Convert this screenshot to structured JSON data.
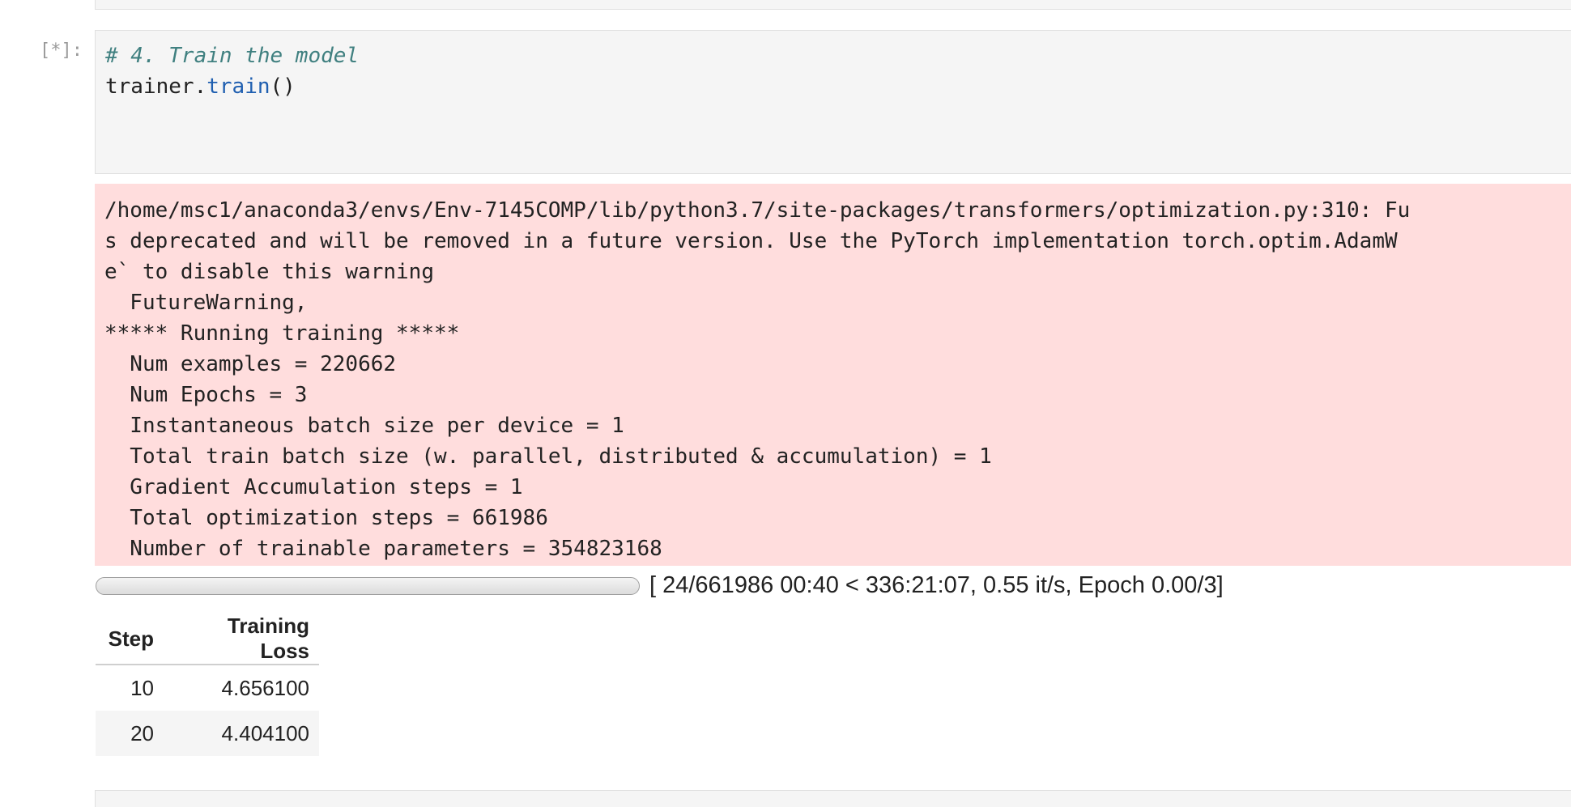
{
  "cell": {
    "prompt": "[*]:",
    "code": {
      "comment": "# 4. Train the model",
      "line2_obj": "trainer.",
      "line2_fn": "train",
      "line2_rest": "()"
    }
  },
  "stderr": {
    "lines": [
      "/home/msc1/anaconda3/envs/Env-7145COMP/lib/python3.7/site-packages/transformers/optimization.py:310: Fu",
      "s deprecated and will be removed in a future version. Use the PyTorch implementation torch.optim.AdamW",
      "e` to disable this warning",
      "  FutureWarning,",
      "***** Running training *****",
      "  Num examples = 220662",
      "  Num Epochs = 3",
      "  Instantaneous batch size per device = 1",
      "  Total train batch size (w. parallel, distributed & accumulation) = 1",
      "  Gradient Accumulation steps = 1",
      "  Total optimization steps = 661986",
      "  Number of trainable parameters = 354823168"
    ]
  },
  "progress": {
    "fraction": 3.63e-05,
    "text": "[ 24/661986 00:40 < 336:21:07, 0.55 it/s, Epoch 0.00/3]"
  },
  "loss_table": {
    "headers": [
      "Step",
      "Training Loss"
    ],
    "rows": [
      [
        "10",
        "4.656100"
      ],
      [
        "20",
        "4.404100"
      ]
    ]
  }
}
